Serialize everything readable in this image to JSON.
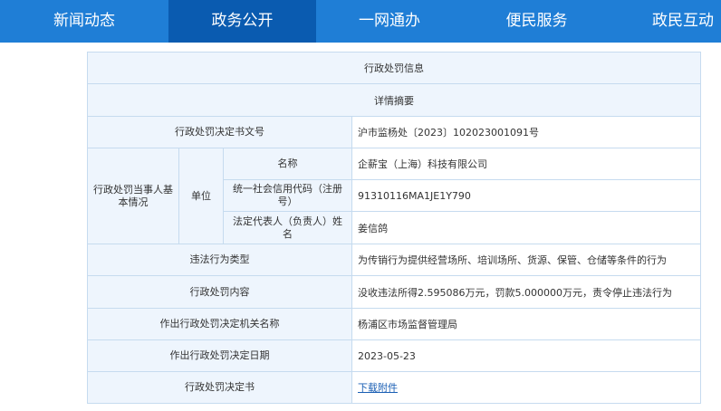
{
  "nav": {
    "items": [
      "新闻动态",
      "政务公开",
      "一网通办",
      "便民服务",
      "政民互动"
    ],
    "active_index": 1
  },
  "table": {
    "title": "行政处罚信息",
    "subtitle": "详情摘要",
    "decision_no_label": "行政处罚决定书文号",
    "decision_no_value": "沪市监杨处〔2023〕102023001091号",
    "party_label": "行政处罚当事人基本情况",
    "unit_label": "单位",
    "name_label": "名称",
    "name_value": "企薪宝（上海）科技有限公司",
    "credit_code_label": "统一社会信用代码（注册号）",
    "credit_code_value": "91310116MA1JE1Y790",
    "legal_rep_label": "法定代表人（负责人）姓名",
    "legal_rep_value": "姜信鸽",
    "violation_type_label": "违法行为类型",
    "violation_type_value": "为传销行为提供经营场所、培训场所、货源、保管、仓储等条件的行为",
    "penalty_content_label": "行政处罚内容",
    "penalty_content_value": "没收违法所得2.595086万元，罚款5.000000万元，责令停止违法行为",
    "authority_label": "作出行政处罚决定机关名称",
    "authority_value": "杨浦区市场监督管理局",
    "date_label": "作出行政处罚决定日期",
    "date_value": "2023-05-23",
    "document_label": "行政处罚决定书",
    "download_link": "下载附件"
  }
}
